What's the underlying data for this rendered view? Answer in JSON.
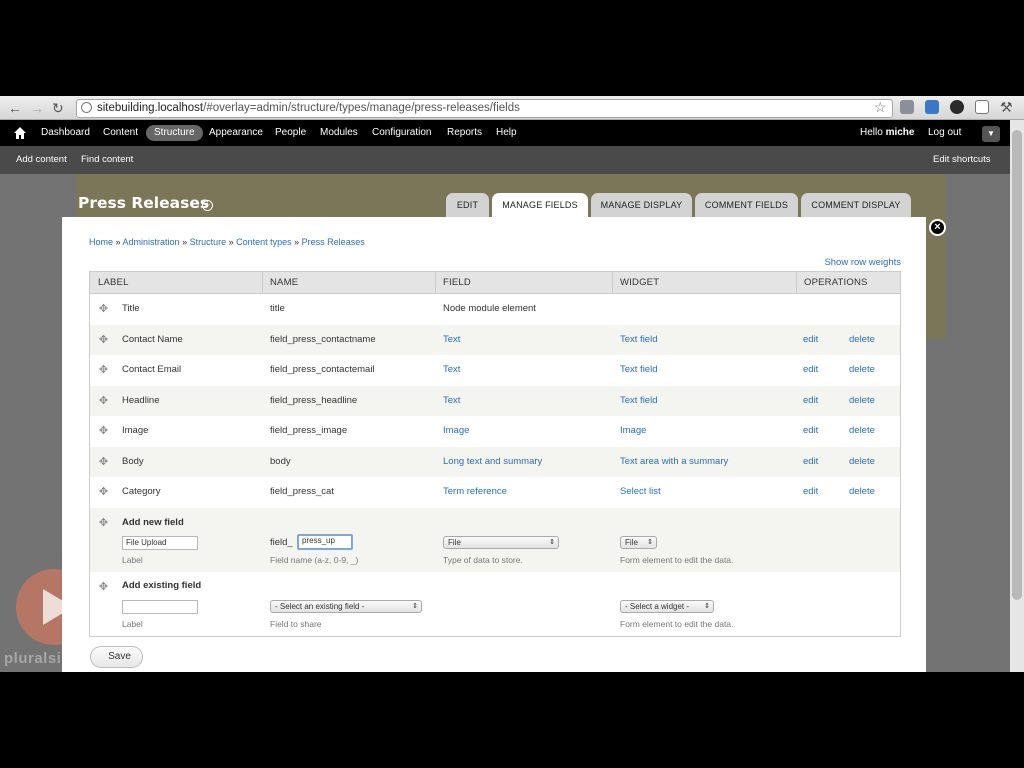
{
  "browser": {
    "url_host": "sitebuilding.localhost",
    "url_path": "/#overlay=admin/structure/types/manage/press-releases/fields",
    "back_icon": "back-arrow-icon",
    "forward_icon": "forward-arrow-icon",
    "reload_icon": "reload-icon"
  },
  "toolbar": {
    "items": [
      "Dashboard",
      "Content",
      "Structure",
      "Appearance",
      "People",
      "Modules",
      "Configuration",
      "Reports",
      "Help"
    ],
    "active": "Structure",
    "greeting_prefix": "Hello ",
    "user": "miche",
    "logout": "Log out"
  },
  "shortcuts": {
    "items": [
      "Add content",
      "Find content"
    ],
    "edit": "Edit shortcuts"
  },
  "page": {
    "title": "Press Releases",
    "tabs": [
      "EDIT",
      "MANAGE FIELDS",
      "MANAGE DISPLAY",
      "COMMENT FIELDS",
      "COMMENT DISPLAY"
    ],
    "active_tab": "MANAGE FIELDS"
  },
  "breadcrumb": [
    "Home",
    "Administration",
    "Structure",
    "Content types",
    "Press Releases"
  ],
  "breadcrumb_sep": " » ",
  "show_row_weights": "Show row weights",
  "table": {
    "headers": [
      "LABEL",
      "NAME",
      "FIELD",
      "WIDGET",
      "OPERATIONS"
    ],
    "rows": [
      {
        "label": "Title",
        "name": "title",
        "field": "Node module element",
        "widget": "",
        "edit": "",
        "delete": ""
      },
      {
        "label": "Contact Name",
        "name": "field_press_contactname",
        "field": "Text",
        "widget": "Text field",
        "edit": "edit",
        "delete": "delete"
      },
      {
        "label": "Contact Email",
        "name": "field_press_contactemail",
        "field": "Text",
        "widget": "Text field",
        "edit": "edit",
        "delete": "delete"
      },
      {
        "label": "Headline",
        "name": "field_press_headline",
        "field": "Text",
        "widget": "Text field",
        "edit": "edit",
        "delete": "delete"
      },
      {
        "label": "Image",
        "name": "field_press_image",
        "field": "Image",
        "widget": "Image",
        "edit": "edit",
        "delete": "delete"
      },
      {
        "label": "Body",
        "name": "body",
        "field": "Long text and summary",
        "widget": "Text area with a summary",
        "edit": "edit",
        "delete": "delete"
      },
      {
        "label": "Category",
        "name": "field_press_cat",
        "field": "Term reference",
        "widget": "Select list",
        "edit": "edit",
        "delete": "delete"
      }
    ]
  },
  "add_new_field": {
    "title": "Add new field",
    "label_value": "File Upload",
    "label_hint": "Label",
    "name_prefix": "field_",
    "name_value": "press_up",
    "name_hint": "Field name (a-z, 0-9, _)",
    "field_type": "File",
    "field_hint": "Type of data to store.",
    "widget": "File",
    "widget_hint": "Form element to edit the data."
  },
  "add_existing_field": {
    "title": "Add existing field",
    "label_value": "",
    "label_hint": "Label",
    "field_select": "- Select an existing field -",
    "field_hint": "Field to share",
    "widget_select": "- Select a widget -",
    "widget_hint": "Form element to edit the data."
  },
  "save_button": "Save",
  "watermark_text": "pluralsight"
}
